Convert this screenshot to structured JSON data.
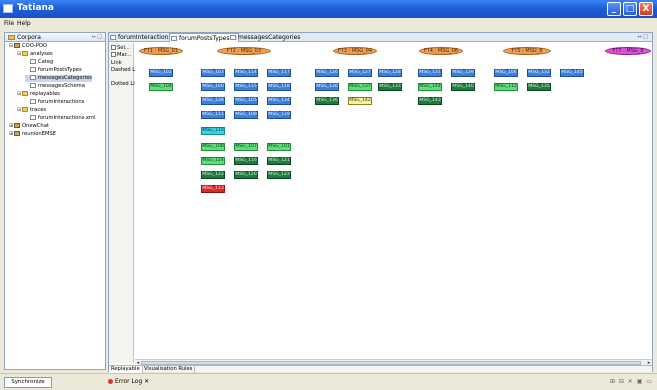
{
  "window": {
    "title": "Tatiana",
    "min": "_",
    "max": "□",
    "close": "X"
  },
  "menu": [
    "File",
    "Help"
  ],
  "left_view": {
    "title": "Corpora",
    "controls": "⇔ □",
    "tree": [
      {
        "label": "COO-POO",
        "level": 0,
        "type": "proj",
        "twisty": "⊟"
      },
      {
        "label": "analyses",
        "level": 1,
        "type": "folder",
        "twisty": "⊟"
      },
      {
        "label": "Categ",
        "level": 2,
        "type": "file",
        "twisty": ""
      },
      {
        "label": "forumPostsTypes",
        "level": 2,
        "type": "file",
        "twisty": ""
      },
      {
        "label": "messagesCategories",
        "level": 2,
        "type": "file",
        "twisty": "",
        "selected": true
      },
      {
        "label": "messagesSchema",
        "level": 2,
        "type": "file",
        "twisty": ""
      },
      {
        "label": "replayables",
        "level": 1,
        "type": "folder",
        "twisty": "⊟"
      },
      {
        "label": "forumInteractions",
        "level": 2,
        "type": "file",
        "twisty": ""
      },
      {
        "label": "traces",
        "level": 1,
        "type": "folder",
        "twisty": "⊟"
      },
      {
        "label": "forumInteractions.xml",
        "level": 2,
        "type": "file",
        "twisty": ""
      },
      {
        "label": "OnewChat",
        "level": 0,
        "type": "proj",
        "twisty": "⊞"
      },
      {
        "label": "reunionEMSE",
        "level": 0,
        "type": "proj",
        "twisty": "⊞"
      }
    ]
  },
  "editor": {
    "tabs": [
      {
        "label": "forumInteractions",
        "active": false,
        "close": ""
      },
      {
        "label": "forumPostsTypes",
        "active": true,
        "close": "✕"
      },
      {
        "label": "messagesCategories",
        "active": false,
        "close": ""
      }
    ],
    "tab_controls": "⇔ □",
    "palette": [
      "Sel...",
      "Mar...",
      "Link",
      "Dashed Link",
      "Dotted Link"
    ],
    "bottom_tabs": [
      {
        "label": "Replayable",
        "active": true
      },
      {
        "label": "Visualisation Rules",
        "active": false
      }
    ],
    "scroll_left": "◂",
    "scroll_right": "▸"
  },
  "graph": {
    "types": [
      {
        "label": "FT1 : MSG_01",
        "color": "orange"
      },
      {
        "label": "FT2 : MSG_03",
        "color": "orange"
      },
      {
        "label": "FT3 : MSG_04",
        "color": "orange"
      },
      {
        "label": "FT4 : MSG_06",
        "color": "orange"
      },
      {
        "label": "FT5 : MSG_8",
        "color": "orange"
      },
      {
        "label": "FT7 : MSG_9",
        "color": "magenta"
      }
    ],
    "messages": [
      {
        "label": "MSG_102",
        "color": "blue",
        "col": 0,
        "row": 0
      },
      {
        "label": "MSG_104",
        "color": "green",
        "col": 0,
        "row": 1
      },
      {
        "label": "MSG_103",
        "color": "blue",
        "col": 1,
        "row": 0
      },
      {
        "label": "MSG_100",
        "color": "blue",
        "col": 1,
        "row": 1
      },
      {
        "label": "MSG_138",
        "color": "blue",
        "col": 1,
        "row": 2
      },
      {
        "label": "MSG_111",
        "color": "blue",
        "col": 1,
        "row": 3
      },
      {
        "label": "MSG_110",
        "color": "cyan",
        "col": 1,
        "row": 4
      },
      {
        "label": "MSG_108",
        "color": "green",
        "col": 1,
        "row": 5
      },
      {
        "label": "MSG_124",
        "color": "green",
        "col": 1,
        "row": 6
      },
      {
        "label": "MSG_122",
        "color": "dkgreen",
        "col": 1,
        "row": 7
      },
      {
        "label": "MSG_113",
        "color": "red",
        "col": 1,
        "row": 8
      },
      {
        "label": "MSG_114",
        "color": "blue",
        "col": 2,
        "row": 0
      },
      {
        "label": "MSG_115",
        "color": "blue",
        "col": 2,
        "row": 1
      },
      {
        "label": "MSG_105",
        "color": "blue",
        "col": 2,
        "row": 2
      },
      {
        "label": "MSG_109",
        "color": "blue",
        "col": 2,
        "row": 3
      },
      {
        "label": "MSG_107",
        "color": "green",
        "col": 2,
        "row": 5
      },
      {
        "label": "MSG_116",
        "color": "dkgreen",
        "col": 2,
        "row": 6
      },
      {
        "label": "MSG_120",
        "color": "dkgreen",
        "col": 2,
        "row": 7
      },
      {
        "label": "MSG_117",
        "color": "blue",
        "col": 3,
        "row": 0
      },
      {
        "label": "MSG_118",
        "color": "blue",
        "col": 3,
        "row": 1
      },
      {
        "label": "MSG_134",
        "color": "blue",
        "col": 3,
        "row": 2
      },
      {
        "label": "MSG_119",
        "color": "blue",
        "col": 3,
        "row": 3
      },
      {
        "label": "MSG_101",
        "color": "green",
        "col": 3,
        "row": 5
      },
      {
        "label": "MSG_121",
        "color": "dkgreen",
        "col": 3,
        "row": 6
      },
      {
        "label": "MSG_123",
        "color": "dkgreen",
        "col": 3,
        "row": 7
      },
      {
        "label": "MSG_126",
        "color": "blue",
        "col": 4,
        "row": 0
      },
      {
        "label": "MSG_130",
        "color": "blue",
        "col": 4,
        "row": 1
      },
      {
        "label": "MSG_136",
        "color": "dkgreen",
        "col": 4,
        "row": 2
      },
      {
        "label": "MSG_127",
        "color": "blue",
        "col": 5,
        "row": 0
      },
      {
        "label": "MSG_137",
        "color": "green",
        "col": 5,
        "row": 1
      },
      {
        "label": "MSG_142",
        "color": "yellow",
        "col": 5,
        "row": 2
      },
      {
        "label": "MSG_128",
        "color": "blue",
        "col": 6,
        "row": 0
      },
      {
        "label": "MSG_133",
        "color": "dkgreen",
        "col": 6,
        "row": 1
      },
      {
        "label": "MSG_131",
        "color": "blue",
        "col": 7,
        "row": 0
      },
      {
        "label": "MSG_144",
        "color": "green",
        "col": 7,
        "row": 1
      },
      {
        "label": "MSG_143",
        "color": "dkgreen",
        "col": 7,
        "row": 2
      },
      {
        "label": "MSG_139",
        "color": "blue",
        "col": 8,
        "row": 0
      },
      {
        "label": "MSG_140",
        "color": "dkgreen",
        "col": 8,
        "row": 1
      },
      {
        "label": "MSG_106",
        "color": "blue",
        "col": 9,
        "row": 0
      },
      {
        "label": "MSG_112",
        "color": "green",
        "col": 9,
        "row": 1
      },
      {
        "label": "MSG_132",
        "color": "blue",
        "col": 10,
        "row": 0
      },
      {
        "label": "MSG_135",
        "color": "dkgreen",
        "col": 10,
        "row": 1
      },
      {
        "label": "MSG_145",
        "color": "blue",
        "col": 11,
        "row": 0
      }
    ]
  },
  "status": {
    "synchronize": "Synchronize",
    "error_log": "Error Log",
    "error_log_close": "✕",
    "icons": "⊞ ⊟ ✕ ▣ ▭"
  }
}
